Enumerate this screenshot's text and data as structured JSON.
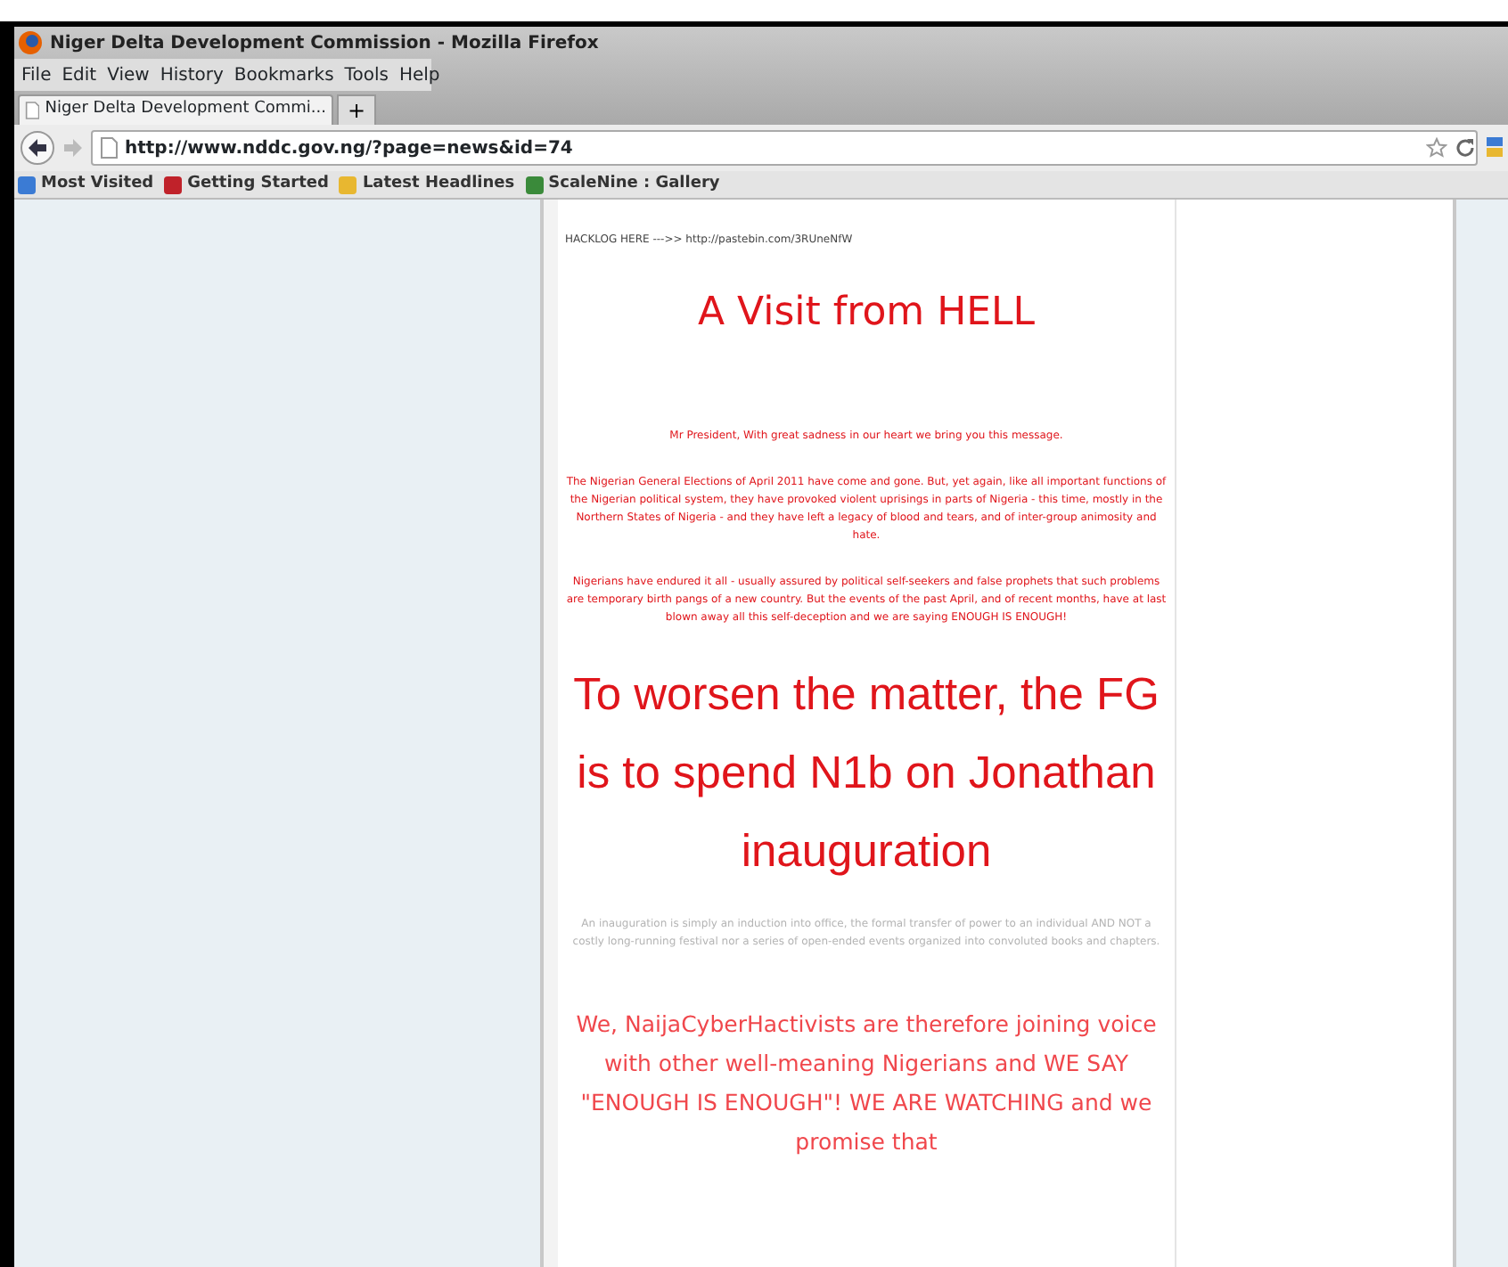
{
  "window": {
    "title": "Niger Delta Development Commission - Mozilla Firefox"
  },
  "menu": [
    "File",
    "Edit",
    "View",
    "History",
    "Bookmarks",
    "Tools",
    "Help"
  ],
  "tabs": [
    {
      "label": "Niger Delta Development Commi...",
      "selected": true
    }
  ],
  "new_tab": "+",
  "address_bar": {
    "value": "http://www.nddc.gov.ng/?page=news&id=74"
  },
  "bookmarks": [
    {
      "label": "Most Visited",
      "color": "#3b7bd4"
    },
    {
      "label": "Getting Started",
      "color": "#c0222a"
    },
    {
      "label": "Latest Headlines",
      "color": "#e8b730"
    },
    {
      "label": "ScaleNine : Gallery",
      "color": "#3a8a3a"
    }
  ],
  "page": {
    "blocks": [
      {
        "kind": "note",
        "text": "HACKLOG HERE --->> http://pastebin.com/3RUneNfW"
      },
      {
        "kind": "title",
        "text": "A Visit from HELL"
      },
      {
        "kind": "body",
        "text": "Mr President, With great sadness in our heart we bring you this message."
      },
      {
        "kind": "body",
        "text": "The Nigerian General Elections of April 2011 have come and gone. But, yet again, like all important functions of the Nigerian political system, they have provoked violent uprisings in parts of Nigeria - this time, mostly in the Northern States of Nigeria - and they have left a legacy of blood and tears, and of inter-group animosity and hate."
      },
      {
        "kind": "body",
        "text": "Nigerians have endured it all - usually assured by political self-seekers and false prophets that such problems are temporary birth pangs of a new country. But the events of the past April, and of recent months, have at last blown away all this self-deception and we are saying ENOUGH IS ENOUGH!"
      },
      {
        "kind": "headline",
        "text": "To worsen the matter, the FG is to spend N1b on Jonathan inauguration"
      },
      {
        "kind": "faint",
        "text": "An inauguration is simply an induction into office, the formal transfer of power to an individual AND NOT a costly long-running festival nor a series of open-ended events organized into convoluted books and chapters."
      },
      {
        "kind": "callout",
        "text": "We, NaijaCyberHactivists are therefore joining voice with other well-meaning Nigerians and WE SAY \"ENOUGH IS ENOUGH\"! WE ARE WATCHING and we promise that"
      }
    ]
  }
}
